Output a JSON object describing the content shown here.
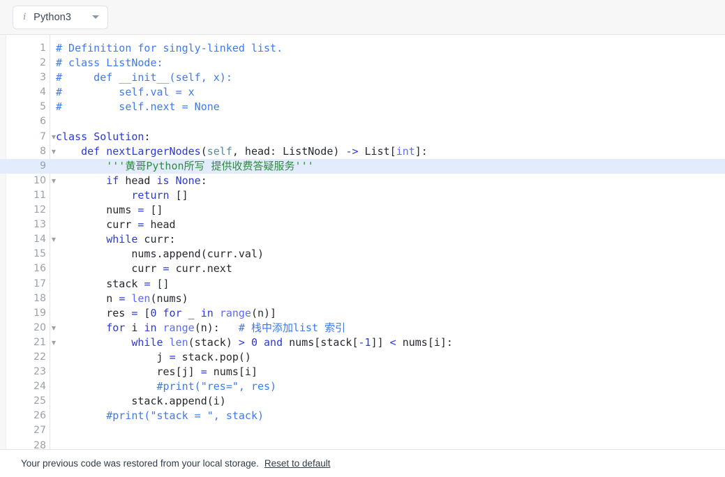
{
  "toolbar": {
    "info_icon": "info-italic-icon",
    "language_label": "Python3",
    "chevron_icon": "chevron-down-icon"
  },
  "editor": {
    "active_line": 9,
    "highlight_color": "#e2ecfd",
    "colors": {
      "comment": "#3e7aec",
      "keyword": "#2a39d6",
      "builtin": "#5c6cf2",
      "string": "#2e8b3d",
      "self_param": "#5a8a9a",
      "plain_text": "#24292e",
      "gutter_text": "#9aa0a6",
      "background": "#ffffff"
    },
    "lines": [
      {
        "n": "1",
        "fold": false,
        "text": "# Definition for singly-linked list.",
        "tokens": [
          [
            "com",
            "# Definition for singly-linked list."
          ]
        ]
      },
      {
        "n": "2",
        "fold": false,
        "text": "# class ListNode:",
        "tokens": [
          [
            "com",
            "# class ListNode:"
          ]
        ]
      },
      {
        "n": "3",
        "fold": false,
        "text": "#     def __init__(self, x):",
        "tokens": [
          [
            "com",
            "#     def __init__(self, x):"
          ]
        ]
      },
      {
        "n": "4",
        "fold": false,
        "text": "#         self.val = x",
        "tokens": [
          [
            "com",
            "#         self.val = x"
          ]
        ]
      },
      {
        "n": "5",
        "fold": false,
        "text": "#         self.next = None",
        "tokens": [
          [
            "com",
            "#         self.next = None"
          ]
        ]
      },
      {
        "n": "6",
        "fold": false,
        "text": "",
        "tokens": []
      },
      {
        "n": "7",
        "fold": true,
        "text": "class Solution:",
        "tokens": [
          [
            "kw",
            "class"
          ],
          [
            "pl",
            " "
          ],
          [
            "fn",
            "Solution"
          ],
          [
            "pl",
            ":"
          ]
        ]
      },
      {
        "n": "8",
        "fold": true,
        "text": "    def nextLargerNodes(self, head: ListNode) -> List[int]:",
        "tokens": [
          [
            "pl",
            "    "
          ],
          [
            "kw",
            "def"
          ],
          [
            "pl",
            " "
          ],
          [
            "fn",
            "nextLargerNodes"
          ],
          [
            "pl",
            "("
          ],
          [
            "self",
            "self"
          ],
          [
            "pl",
            ", head: ListNode) "
          ],
          [
            "op",
            "->"
          ],
          [
            "pl",
            " List["
          ],
          [
            "bi",
            "int"
          ],
          [
            "pl",
            "]:"
          ]
        ]
      },
      {
        "n": "9",
        "fold": false,
        "active": true,
        "text": "        '''黄哥Python所写 提供收费答疑服务'''",
        "tokens": [
          [
            "pl",
            "        "
          ],
          [
            "str",
            "'''黄哥Python所写 提供收费答疑服务'''"
          ]
        ]
      },
      {
        "n": "10",
        "fold": true,
        "text": "        if head is None:",
        "tokens": [
          [
            "pl",
            "        "
          ],
          [
            "kw",
            "if"
          ],
          [
            "pl",
            " head "
          ],
          [
            "kw",
            "is"
          ],
          [
            "pl",
            " "
          ],
          [
            "kw",
            "None"
          ],
          [
            "pl",
            ":"
          ]
        ]
      },
      {
        "n": "11",
        "fold": false,
        "text": "            return []",
        "tokens": [
          [
            "pl",
            "            "
          ],
          [
            "kw",
            "return"
          ],
          [
            "pl",
            " []"
          ]
        ]
      },
      {
        "n": "12",
        "fold": false,
        "text": "        nums = []",
        "tokens": [
          [
            "pl",
            "        nums "
          ],
          [
            "op",
            "="
          ],
          [
            "pl",
            " []"
          ]
        ]
      },
      {
        "n": "13",
        "fold": false,
        "text": "        curr = head",
        "tokens": [
          [
            "pl",
            "        curr "
          ],
          [
            "op",
            "="
          ],
          [
            "pl",
            " head"
          ]
        ]
      },
      {
        "n": "14",
        "fold": true,
        "text": "        while curr:",
        "tokens": [
          [
            "pl",
            "        "
          ],
          [
            "kw",
            "while"
          ],
          [
            "pl",
            " curr:"
          ]
        ]
      },
      {
        "n": "15",
        "fold": false,
        "text": "            nums.append(curr.val)",
        "tokens": [
          [
            "pl",
            "            nums.append(curr.val)"
          ]
        ]
      },
      {
        "n": "16",
        "fold": false,
        "text": "            curr = curr.next",
        "tokens": [
          [
            "pl",
            "            curr "
          ],
          [
            "op",
            "="
          ],
          [
            "pl",
            " curr.next"
          ]
        ]
      },
      {
        "n": "17",
        "fold": false,
        "text": "        stack = []",
        "tokens": [
          [
            "pl",
            "        stack "
          ],
          [
            "op",
            "="
          ],
          [
            "pl",
            " []"
          ]
        ]
      },
      {
        "n": "18",
        "fold": false,
        "text": "        n = len(nums)",
        "tokens": [
          [
            "pl",
            "        n "
          ],
          [
            "op",
            "="
          ],
          [
            "pl",
            " "
          ],
          [
            "bi",
            "len"
          ],
          [
            "pl",
            "(nums)"
          ]
        ]
      },
      {
        "n": "19",
        "fold": false,
        "text": "        res = [0 for _ in range(n)]",
        "tokens": [
          [
            "pl",
            "        res "
          ],
          [
            "op",
            "="
          ],
          [
            "pl",
            " ["
          ],
          [
            "num",
            "0"
          ],
          [
            "pl",
            " "
          ],
          [
            "kw",
            "for"
          ],
          [
            "pl",
            " _ "
          ],
          [
            "kw",
            "in"
          ],
          [
            "pl",
            " "
          ],
          [
            "bi",
            "range"
          ],
          [
            "pl",
            "(n)]"
          ]
        ]
      },
      {
        "n": "20",
        "fold": true,
        "text": "        for i in range(n):   # 栈中添加list 索引",
        "tokens": [
          [
            "pl",
            "        "
          ],
          [
            "kw",
            "for"
          ],
          [
            "pl",
            " i "
          ],
          [
            "kw",
            "in"
          ],
          [
            "pl",
            " "
          ],
          [
            "bi",
            "range"
          ],
          [
            "pl",
            "(n):   "
          ],
          [
            "com",
            "# 栈中添加list 索引"
          ]
        ]
      },
      {
        "n": "21",
        "fold": true,
        "text": "            while len(stack) > 0 and nums[stack[-1]] < nums[i]:",
        "tokens": [
          [
            "pl",
            "            "
          ],
          [
            "kw",
            "while"
          ],
          [
            "pl",
            " "
          ],
          [
            "bi",
            "len"
          ],
          [
            "pl",
            "(stack) "
          ],
          [
            "op",
            ">"
          ],
          [
            "pl",
            " "
          ],
          [
            "num",
            "0"
          ],
          [
            "pl",
            " "
          ],
          [
            "kw",
            "and"
          ],
          [
            "pl",
            " nums[stack["
          ],
          [
            "num",
            "-1"
          ],
          [
            "pl",
            "]] "
          ],
          [
            "op",
            "<"
          ],
          [
            "pl",
            " nums[i]:"
          ]
        ]
      },
      {
        "n": "22",
        "fold": false,
        "text": "                j = stack.pop()",
        "tokens": [
          [
            "pl",
            "                j "
          ],
          [
            "op",
            "="
          ],
          [
            "pl",
            " stack.pop()"
          ]
        ]
      },
      {
        "n": "23",
        "fold": false,
        "text": "                res[j] = nums[i]",
        "tokens": [
          [
            "pl",
            "                res[j] "
          ],
          [
            "op",
            "="
          ],
          [
            "pl",
            " nums[i]"
          ]
        ]
      },
      {
        "n": "24",
        "fold": false,
        "text": "                #print(\"res=\", res)",
        "tokens": [
          [
            "pl",
            "                "
          ],
          [
            "com",
            "#print(\"res=\", res)"
          ]
        ]
      },
      {
        "n": "25",
        "fold": false,
        "text": "            stack.append(i)",
        "tokens": [
          [
            "pl",
            "            stack.append(i)"
          ]
        ]
      },
      {
        "n": "26",
        "fold": false,
        "text": "        #print(\"stack = \", stack)",
        "tokens": [
          [
            "pl",
            "        "
          ],
          [
            "com",
            "#print(\"stack = \", stack)"
          ]
        ]
      },
      {
        "n": "27",
        "fold": false,
        "text": "",
        "tokens": []
      },
      {
        "n": "28",
        "fold": false,
        "text": "",
        "tokens": []
      }
    ]
  },
  "statusbar": {
    "message": "Your previous code was restored from your local storage.",
    "reset_link": "Reset to default"
  }
}
